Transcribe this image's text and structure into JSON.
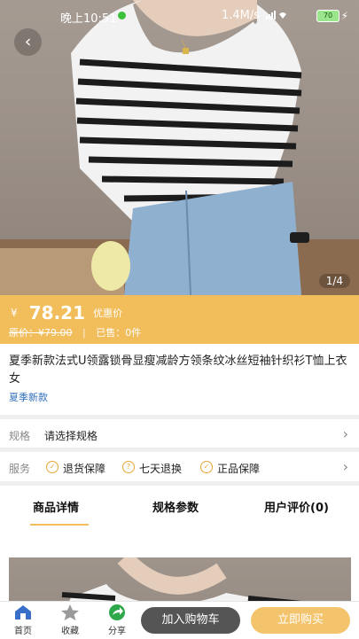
{
  "status": {
    "time": "晚上10:51",
    "speed": "1.4M/s",
    "battery": "70"
  },
  "gallery": {
    "counter": "1/4"
  },
  "price": {
    "currency": "¥",
    "value": "78.21",
    "label": "优惠价",
    "original": "原价：¥79.00",
    "sold": "已售：0件"
  },
  "product": {
    "title": "夏季新款法式U领露锁骨显瘦减龄方领条纹冰丝短袖针织衫T恤上衣女",
    "tag": "夏季新款"
  },
  "spec": {
    "label": "规格",
    "value": "请选择规格"
  },
  "service": {
    "label": "服务",
    "items": [
      "退货保障",
      "七天退换",
      "正品保障"
    ]
  },
  "tabs": [
    "商品详情",
    "规格参数",
    "用户评价(0)"
  ],
  "bottom": {
    "home": "首页",
    "favorite": "收藏",
    "share": "分享",
    "add_to_cart": "加入购物车",
    "buy_now": "立即购买"
  },
  "colors": {
    "accent": "#f2bd5b",
    "link": "#2f6dbb",
    "dark_button": "#555555"
  }
}
